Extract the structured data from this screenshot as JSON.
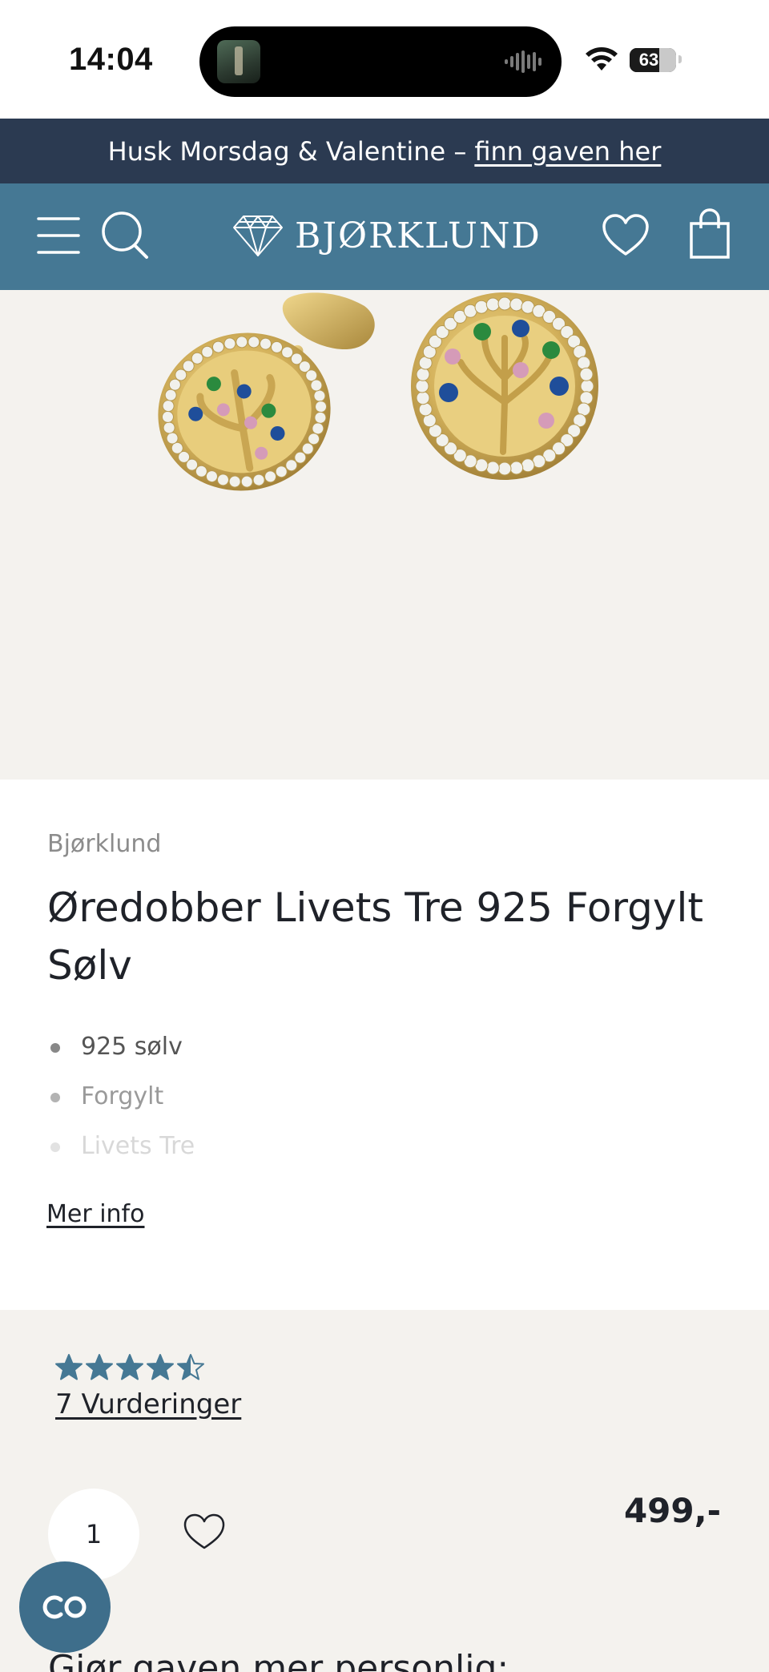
{
  "status_bar": {
    "time": "14:04",
    "battery_level": "63",
    "battery_percent": 63,
    "icons": [
      "dynamic-island-media-art",
      "audio-wave-icon",
      "wifi-icon",
      "battery-icon"
    ]
  },
  "promo": {
    "text": "Husk Morsdag & Valentine –",
    "link": "finn gaven her"
  },
  "header": {
    "logo_text": "BJØRKLUND",
    "icons": [
      "menu-icon",
      "search-icon",
      "diamond-logo-icon",
      "heart-icon",
      "shopping-bag-icon"
    ],
    "background_color": "#457894"
  },
  "product": {
    "brand": "Bjørklund",
    "title": "Øredobber Livets Tre 925 Forgylt Sølv",
    "features": [
      "925 sølv",
      "Forgylt",
      "Livets Tre"
    ],
    "more_info": "Mer info",
    "image_alt": "tree-of-life-earrings-image"
  },
  "purchase": {
    "rating": 4.5,
    "rating_max": 5,
    "reviews_label": "7 Vurderinger",
    "quantity": "1",
    "price": "499,-",
    "personalize_heading": "Gjør gaven mer personlig:",
    "chat_icon": "chat-co-icon"
  },
  "colors": {
    "banner": "#2b3a51",
    "header": "#457894",
    "star": "#457894",
    "background_light": "#f4f2ee"
  }
}
